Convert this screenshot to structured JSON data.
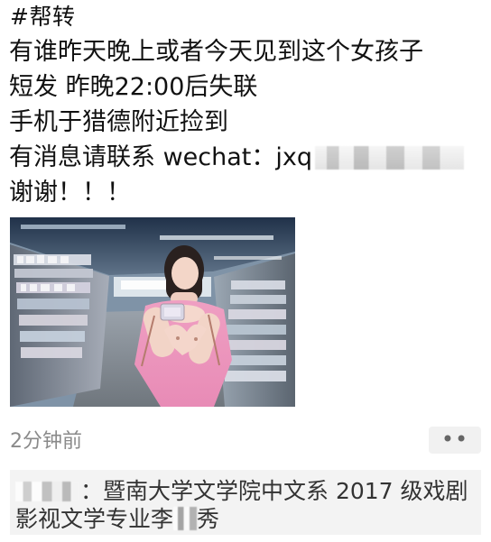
{
  "post": {
    "header": "#帮转",
    "lines": [
      "有谁昨天晚上或者今天见到这个女孩子",
      "短发 昨晚22:00后失联",
      "手机于猎德附近捡到",
      "有消息请联系 wechat：jxq",
      "谢谢！！！"
    ]
  },
  "meta": {
    "timestamp": "2分钟前",
    "more_label": "••"
  },
  "comment": {
    "line1_text": "：暨南大学文学院中文系 2017 级戏剧",
    "line2_prefix": "影视文学专业李",
    "line2_suffix": "秀"
  },
  "colors": {
    "text": "#111111",
    "muted": "#8a8a8a",
    "comment_bg": "#f3f3f3",
    "button_bg": "#f1f1f1"
  },
  "icons": {
    "more": "more-dots-icon"
  }
}
